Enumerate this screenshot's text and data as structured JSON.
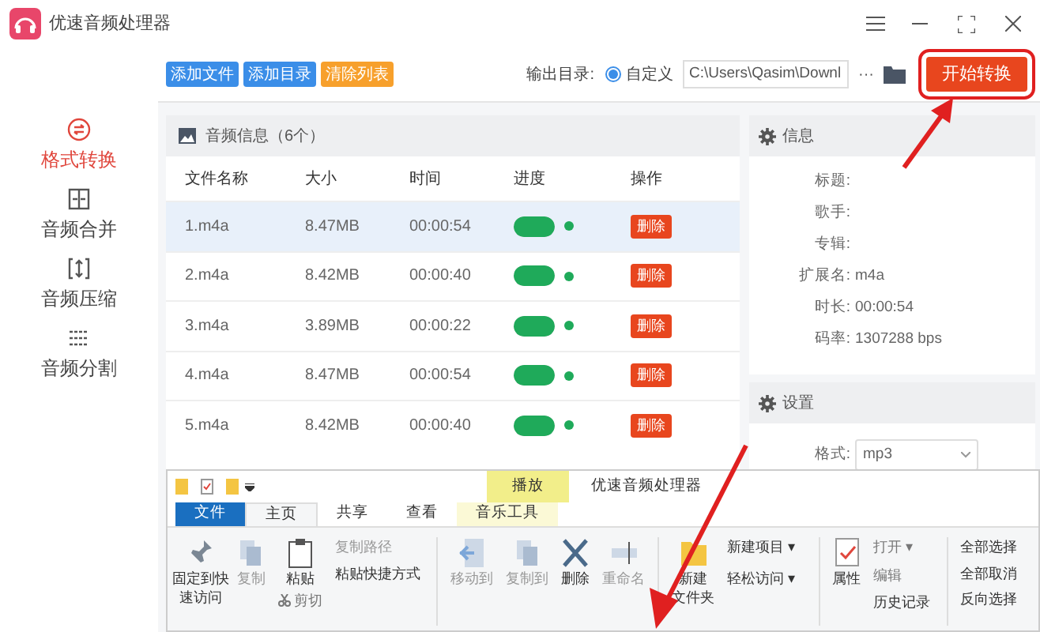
{
  "window": {
    "title": "优速音频处理器"
  },
  "sidebar": {
    "items": [
      {
        "label": "格式转换",
        "selected": true,
        "kind": "convert"
      },
      {
        "label": "音频合并",
        "selected": false,
        "kind": "merge"
      },
      {
        "label": "音频压缩",
        "selected": false,
        "kind": "compress"
      },
      {
        "label": "音频分割",
        "selected": false,
        "kind": "split"
      }
    ]
  },
  "toolbar": {
    "buttons": [
      {
        "label": "添加文件",
        "kind": "primary"
      },
      {
        "label": "添加目录",
        "kind": "primary"
      },
      {
        "label": "清除列表",
        "kind": "warning"
      }
    ],
    "output_label": "输出目录:",
    "radio": {
      "label": "自定义",
      "selected": true
    },
    "path": "C:\\Users\\Qasim\\Downl",
    "more": "···",
    "start_button": "开始转换"
  },
  "file_panel": {
    "title": "音频信息（6个）",
    "columns": [
      "文件名称",
      "大小",
      "时间",
      "进度",
      "操作"
    ],
    "rows": [
      {
        "name": "1.m4a",
        "size": "8.47MB",
        "time": "00:00:54",
        "level": 1,
        "done": true,
        "action": "删除",
        "selected": true
      },
      {
        "name": "2.m4a",
        "size": "8.42MB",
        "time": "00:00:40",
        "level": 1,
        "done": true,
        "action": "删除",
        "selected": false
      },
      {
        "name": "3.m4a",
        "size": "3.89MB",
        "time": "00:00:22",
        "level": 1,
        "done": true,
        "action": "删除",
        "selected": false
      },
      {
        "name": "4.m4a",
        "size": "8.47MB",
        "time": "00:00:54",
        "level": 1,
        "done": true,
        "action": "删除",
        "selected": false
      },
      {
        "name": "5.m4a",
        "size": "8.42MB",
        "time": "00:00:40",
        "level": 1,
        "done": true,
        "action": "删除",
        "selected": false
      }
    ]
  },
  "info_panel": {
    "title": "信息",
    "fields": [
      {
        "label": "标题:"
      },
      {
        "label": "歌手:"
      },
      {
        "label": "专辑:"
      },
      {
        "label": "扩展名:",
        "value": "m4a"
      },
      {
        "label": "时长:",
        "value": "00:00:54"
      },
      {
        "label": "码率:",
        "value": "1307288 bps"
      }
    ]
  },
  "settings_panel": {
    "title": "设置",
    "format_label": "格式:",
    "format_value": "mp3"
  },
  "explorer": {
    "context_tab": "播放",
    "title": "优速音频处理器",
    "tabs": [
      {
        "label": "文件",
        "selected": false,
        "kind": "file"
      },
      {
        "label": "主页",
        "selected": true,
        "kind": "tab"
      },
      {
        "label": "共享",
        "selected": false,
        "kind": "tab"
      },
      {
        "label": "查看",
        "selected": false,
        "kind": "tab"
      },
      {
        "label": "音乐工具",
        "selected": false,
        "kind": "tab"
      }
    ],
    "pin": "固定到快速访问",
    "copy": "复制",
    "paste": "粘贴",
    "copy_path": "复制路径",
    "paste_shortcut": "粘贴快捷方式",
    "cut": "剪切",
    "move_to": "移动到",
    "copy_to": "复制到",
    "delete": "删除",
    "rename": "重命名",
    "new_folder": [
      "新建",
      "文件夹"
    ],
    "new_item": "新建项目 ▾",
    "easy_access": "轻松访问 ▾",
    "properties": "属性",
    "open": "打开 ▾",
    "edit": "编辑",
    "history": "历史记录",
    "select_all": "全部选择",
    "select_none": "全部取消",
    "invert": "反向选择"
  }
}
